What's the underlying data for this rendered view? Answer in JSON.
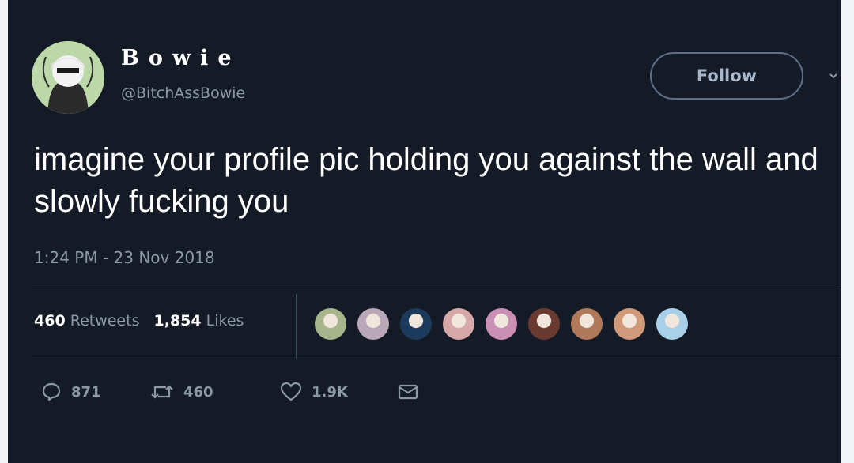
{
  "tweet": {
    "display_name": "Bowie",
    "handle": "@BitchAssBowie",
    "follow_label": "Follow",
    "text": "imagine your profile pic holding you against the wall and slowly fucking you",
    "timestamp": "1:24 PM - 23 Nov 2018",
    "retweets_count": "460",
    "retweets_label": "Retweets",
    "likes_count": "1,854",
    "likes_label": "Likes"
  },
  "actions": {
    "replies": "871",
    "retweets": "460",
    "likes": "1.9K"
  },
  "likers": [
    {
      "icon": "liker-avatar",
      "color": "#a8b48c"
    },
    {
      "icon": "liker-avatar",
      "color": "#b8a8b8"
    },
    {
      "icon": "liker-avatar",
      "color": "#1c3a5c"
    },
    {
      "icon": "liker-avatar",
      "color": "#d6a8a8"
    },
    {
      "icon": "liker-avatar",
      "color": "#c98fb4"
    },
    {
      "icon": "liker-avatar",
      "color": "#6a3a30"
    },
    {
      "icon": "liker-avatar",
      "color": "#b07a5a"
    },
    {
      "icon": "liker-avatar",
      "color": "#d09a7a"
    },
    {
      "icon": "liker-avatar",
      "color": "#a8d0e8"
    }
  ]
}
